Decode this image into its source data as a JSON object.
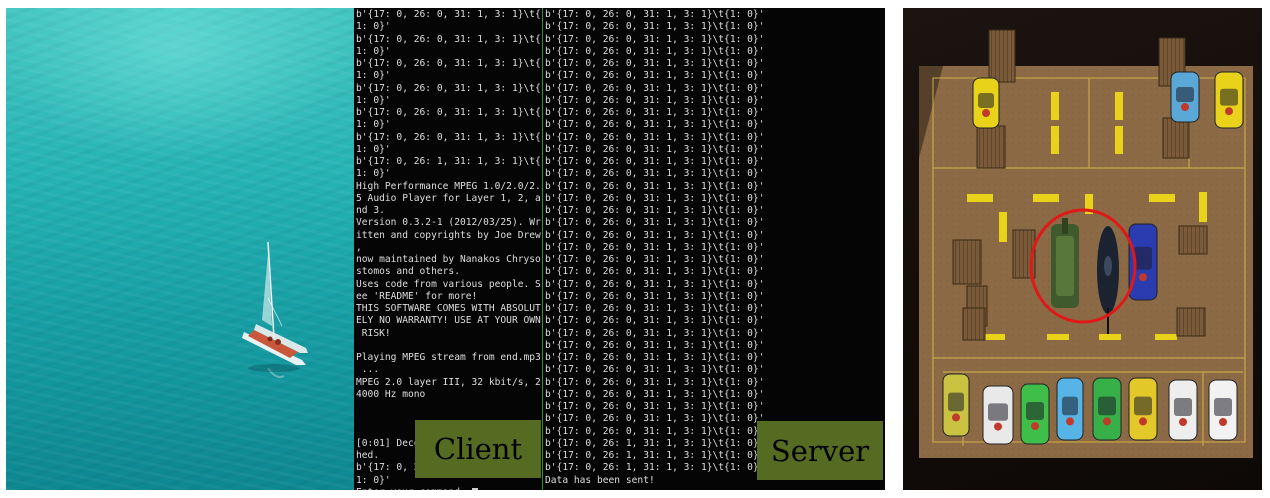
{
  "client": {
    "lines": [
      "b'{17: 0, 26: 0, 31: 1, 3: 1}\\t{",
      "1: 0}'",
      "b'{17: 0, 26: 0, 31: 1, 3: 1}\\t{",
      "1: 0}'",
      "b'{17: 0, 26: 0, 31: 1, 3: 1}\\t{",
      "1: 0}'",
      "b'{17: 0, 26: 0, 31: 1, 3: 1}\\t{",
      "1: 0}'",
      "b'{17: 0, 26: 0, 31: 1, 3: 1}\\t{",
      "1: 0}'",
      "b'{17: 0, 26: 0, 31: 1, 3: 1}\\t{",
      "1: 0}'",
      "b'{17: 0, 26: 1, 31: 1, 3: 1}\\t{",
      "1: 0}'",
      "High Performance MPEG 1.0/2.0/2.",
      "5 Audio Player for Layer 1, 2, a",
      "nd 3.",
      "Version 0.3.2-1 (2012/03/25). Wr",
      "itten and copyrights by Joe Drew",
      ",",
      "now maintained by Nanakos Chryso",
      "stomos and others.",
      "Uses code from various people. S",
      "ee 'README' for more!",
      "THIS SOFTWARE COMES WITH ABSOLUT",
      "ELY NO WARRANTY! USE AT YOUR OWN",
      " RISK!",
      "",
      "Playing MPEG stream from end.mp3",
      " ...",
      "MPEG 2.0 layer III, 32 kbit/s, 2",
      "4000 Hz mono",
      "",
      "",
      "",
      "[0:01] Decoding of end.mp3 finis",
      "hed.",
      "b'{17: 0, 26: 1, 31: 1, 3: 1}\\t{",
      "1: 0}'"
    ],
    "prompt": "Enter your command: ",
    "label": "Client"
  },
  "server": {
    "lines": [
      "b'{17: 0, 26: 0, 31: 1, 3: 1}\\t{1: 0}'",
      "b'{17: 0, 26: 0, 31: 1, 3: 1}\\t{1: 0}'",
      "b'{17: 0, 26: 0, 31: 1, 3: 1}\\t{1: 0}'",
      "b'{17: 0, 26: 0, 31: 1, 3: 1}\\t{1: 0}'",
      "b'{17: 0, 26: 0, 31: 1, 3: 1}\\t{1: 0}'",
      "b'{17: 0, 26: 0, 31: 1, 3: 1}\\t{1: 0}'",
      "b'{17: 0, 26: 0, 31: 1, 3: 1}\\t{1: 0}'",
      "b'{17: 0, 26: 0, 31: 1, 3: 1}\\t{1: 0}'",
      "b'{17: 0, 26: 0, 31: 1, 3: 1}\\t{1: 0}'",
      "b'{17: 0, 26: 0, 31: 1, 3: 1}\\t{1: 0}'",
      "b'{17: 0, 26: 0, 31: 1, 3: 1}\\t{1: 0}'",
      "b'{17: 0, 26: 0, 31: 1, 3: 1}\\t{1: 0}'",
      "b'{17: 0, 26: 0, 31: 1, 3: 1}\\t{1: 0}'",
      "b'{17: 0, 26: 0, 31: 1, 3: 1}\\t{1: 0}'",
      "b'{17: 0, 26: 0, 31: 1, 3: 1}\\t{1: 0}'",
      "b'{17: 0, 26: 0, 31: 1, 3: 1}\\t{1: 0}'",
      "b'{17: 0, 26: 0, 31: 1, 3: 1}\\t{1: 0}'",
      "b'{17: 0, 26: 0, 31: 1, 3: 1}\\t{1: 0}'",
      "b'{17: 0, 26: 0, 31: 1, 3: 1}\\t{1: 0}'",
      "b'{17: 0, 26: 0, 31: 1, 3: 1}\\t{1: 0}'",
      "b'{17: 0, 26: 0, 31: 1, 3: 1}\\t{1: 0}'",
      "b'{17: 0, 26: 0, 31: 1, 3: 1}\\t{1: 0}'",
      "b'{17: 0, 26: 0, 31: 1, 3: 1}\\t{1: 0}'",
      "b'{17: 0, 26: 0, 31: 1, 3: 1}\\t{1: 0}'",
      "b'{17: 0, 26: 0, 31: 1, 3: 1}\\t{1: 0}'",
      "b'{17: 0, 26: 0, 31: 1, 3: 1}\\t{1: 0}'",
      "b'{17: 0, 26: 0, 31: 1, 3: 1}\\t{1: 0}'",
      "b'{17: 0, 26: 0, 31: 1, 3: 1}\\t{1: 0}'",
      "b'{17: 0, 26: 0, 31: 1, 3: 1}\\t{1: 0}'",
      "b'{17: 0, 26: 0, 31: 1, 3: 1}\\t{1: 0}'",
      "b'{17: 0, 26: 0, 31: 1, 3: 1}\\t{1: 0}'",
      "b'{17: 0, 26: 0, 31: 1, 3: 1}\\t{1: 0}'",
      "b'{17: 0, 26: 0, 31: 1, 3: 1}\\t{1: 0}'",
      "b'{17: 0, 26: 0, 31: 1, 3: 1}\\t{1: 0}'",
      "b'{17: 0, 26: 0, 31: 1, 3: 1}\\t{1: 0}'",
      "b'{17: 0, 26: 1, 31: 1, 3: 1}\\t{1: 0}'",
      "b'{17: 0, 26: 1, 31: 1, 3: 1}\\t{1: 0}'",
      "b'{17: 0, 26: 1, 31: 1, 3: 1}\\t{1: 0}'",
      "Data has been sent!"
    ],
    "label": "Server"
  },
  "colors": {
    "label_background": "#556b21",
    "terminal_background": "#050505",
    "terminal_divider": "#2f8f3a",
    "highlight_circle": "#e01818",
    "parking_line": "#e8d21a"
  },
  "icons": [
    "sailboat-icon",
    "toy-car-icon",
    "tank-icon",
    "submarine-icon",
    "pillar-icon"
  ]
}
